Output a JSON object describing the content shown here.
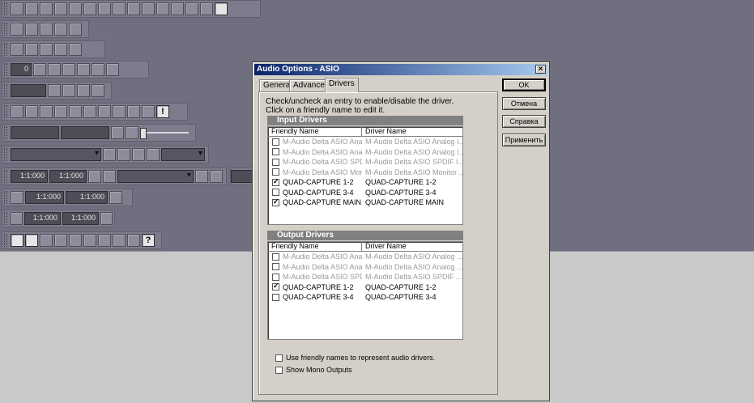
{
  "dialog": {
    "title": "Audio Options - ASIO",
    "close_glyph": "×",
    "tabs": [
      {
        "label": "General",
        "active": false
      },
      {
        "label": "Advanced",
        "active": false
      },
      {
        "label": "Drivers",
        "active": true
      }
    ],
    "instructions": [
      "Check/uncheck an entry to enable/disable the driver.",
      "Click on a friendly name to edit it."
    ],
    "input_group": {
      "title": "Input Drivers",
      "columns": [
        "Friendly Name",
        "Driver Name"
      ],
      "rows": [
        {
          "friendly": "M-Audio Delta ASIO Anal...",
          "driver": "M-Audio Delta ASIO Analog I...",
          "checked": false,
          "disabled": true
        },
        {
          "friendly": "M-Audio Delta ASIO Anal...",
          "driver": "M-Audio Delta ASIO Analog I...",
          "checked": false,
          "disabled": true
        },
        {
          "friendly": "M-Audio Delta ASIO SPD...",
          "driver": "M-Audio Delta ASIO SPDIF I...",
          "checked": false,
          "disabled": true
        },
        {
          "friendly": "M-Audio Delta ASIO Moni...",
          "driver": "M-Audio Delta ASIO Monitor ...",
          "checked": false,
          "disabled": true
        },
        {
          "friendly": "QUAD-CAPTURE 1-2",
          "driver": "QUAD-CAPTURE 1-2",
          "checked": true,
          "disabled": false
        },
        {
          "friendly": "QUAD-CAPTURE 3-4",
          "driver": "QUAD-CAPTURE 3-4",
          "checked": false,
          "disabled": false
        },
        {
          "friendly": "QUAD-CAPTURE MAIN",
          "driver": "QUAD-CAPTURE MAIN",
          "checked": true,
          "disabled": false
        }
      ]
    },
    "output_group": {
      "title": "Output Drivers",
      "columns": [
        "Friendly Name",
        "Driver Name"
      ],
      "rows": [
        {
          "friendly": "M-Audio Delta ASIO Anal...",
          "driver": "M-Audio Delta ASIO Analog ...",
          "checked": false,
          "disabled": true
        },
        {
          "friendly": "M-Audio Delta ASIO Anal...",
          "driver": "M-Audio Delta ASIO Analog ...",
          "checked": false,
          "disabled": true
        },
        {
          "friendly": "M-Audio Delta ASIO SPD...",
          "driver": "M-Audio Delta ASIO SPDIF ...",
          "checked": false,
          "disabled": true
        },
        {
          "friendly": "QUAD-CAPTURE 1-2",
          "driver": "QUAD-CAPTURE 1-2",
          "checked": true,
          "disabled": false
        },
        {
          "friendly": "QUAD-CAPTURE 3-4",
          "driver": "QUAD-CAPTURE 3-4",
          "checked": false,
          "disabled": false
        }
      ]
    },
    "options": [
      {
        "label": "Use friendly names to represent audio drivers.",
        "checked": false
      },
      {
        "label": "Show Mono Outputs",
        "checked": false
      }
    ],
    "buttons": {
      "ok": "OK",
      "cancel": "Отмена",
      "help": "Справка",
      "apply": "Применить"
    }
  },
  "background_toolbars": {
    "counter_value": "0",
    "time_fields": [
      "1:1:000",
      "1:1:000",
      "1:1:000",
      "1:1:000",
      "1:1:000",
      "1:1:000"
    ],
    "question_glyph": "?",
    "alert_glyph": "!"
  }
}
